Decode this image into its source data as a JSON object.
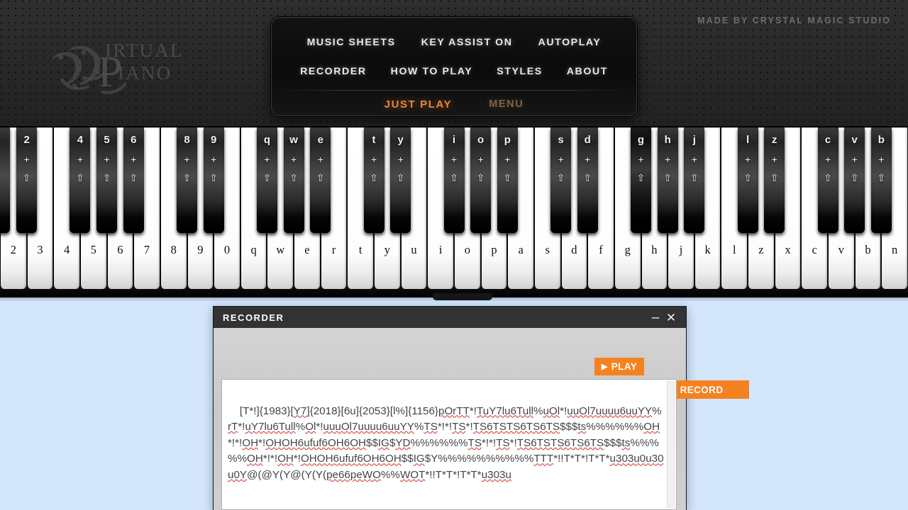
{
  "header": {
    "made_by": "MADE BY CRYSTAL MAGIC STUDIO",
    "logo_line1": "VIRTUAL",
    "logo_line2": "PIANO"
  },
  "menu": {
    "row1": [
      {
        "label": "MUSIC SHEETS",
        "name": "menu-music-sheets"
      },
      {
        "label": "KEY ASSIST ON",
        "name": "menu-key-assist"
      },
      {
        "label": "AUTOPLAY",
        "name": "menu-autoplay"
      }
    ],
    "row2": [
      {
        "label": "RECORDER",
        "name": "menu-recorder"
      },
      {
        "label": "HOW TO PLAY",
        "name": "menu-how-to-play"
      },
      {
        "label": "STYLES",
        "name": "menu-styles"
      },
      {
        "label": "ABOUT",
        "name": "menu-about"
      }
    ],
    "row3": [
      {
        "label": "JUST PLAY",
        "name": "menu-just-play",
        "style": "accent"
      },
      {
        "label": "MENU",
        "name": "menu-menu",
        "style": "dim"
      }
    ],
    "accent_color": "#e8873a",
    "dim_color": "#7a6446"
  },
  "piano": {
    "white_keys": [
      "2",
      "3",
      "4",
      "5",
      "6",
      "7",
      "8",
      "9",
      "0",
      "q",
      "w",
      "e",
      "r",
      "t",
      "y",
      "u",
      "i",
      "o",
      "p",
      "a",
      "s",
      "d",
      "f",
      "g",
      "h",
      "j",
      "k",
      "l",
      "z",
      "x",
      "c",
      "v",
      "b",
      "n"
    ],
    "black_keys": [
      {
        "label": "",
        "after": -1,
        "partial": true
      },
      {
        "label": "2",
        "after": 0
      },
      {
        "label": "4",
        "after": 2
      },
      {
        "label": "5",
        "after": 3
      },
      {
        "label": "6",
        "after": 4
      },
      {
        "label": "8",
        "after": 6
      },
      {
        "label": "9",
        "after": 7
      },
      {
        "label": "q",
        "after": 9
      },
      {
        "label": "w",
        "after": 10
      },
      {
        "label": "e",
        "after": 11
      },
      {
        "label": "t",
        "after": 13
      },
      {
        "label": "y",
        "after": 14
      },
      {
        "label": "i",
        "after": 16
      },
      {
        "label": "o",
        "after": 17
      },
      {
        "label": "p",
        "after": 18
      },
      {
        "label": "s",
        "after": 20
      },
      {
        "label": "d",
        "after": 21
      },
      {
        "label": "g",
        "after": 23,
        "lit": true
      },
      {
        "label": "h",
        "after": 24
      },
      {
        "label": "j",
        "after": 25
      },
      {
        "label": "l",
        "after": 27
      },
      {
        "label": "z",
        "after": 28
      },
      {
        "label": "c",
        "after": 30
      },
      {
        "label": "v",
        "after": 31
      },
      {
        "label": "b",
        "after": 32
      }
    ],
    "modifier_plus": "+",
    "modifier_shift": "⇧"
  },
  "recorder": {
    "title": "RECORDER",
    "minimize_label": "–",
    "close_label": "✕",
    "play_label": "PLAY",
    "play_glyph": "▶",
    "record_label": "RECORD",
    "record_glyph": "●",
    "button_color": "#f58220",
    "recorded_notes": "[T*!]{1983}[Y7]{2018}[6u]{2053}[l%]{1156}pOrTT*!TuY7lu6Tull%uOl*!uuOl7uuuu6uuYY%rT*!uY7lu6Tull%Ol*!uuuOl7uuuu6uuYY%TS*!*!TS*!TS6TSTS6TS6TS$$$ts%%%%%%OH*!*!OH*!OHOH6ufuf6OH6OH$$IG$YD%%%%%%TS*!*!TS*!TS6TSTS6TS6TS$$$ts%%%%%OH*!*!OH*!OHOH6ufuf6OH6OH$$IG$Y%%%%%%%%%%TTT*!!T*T*!T*T*u303u0u30u0Y@(@Y(Y@(Y(Y(pe66peWO%%WOT*!!T*T*!T*T*u303u"
  }
}
